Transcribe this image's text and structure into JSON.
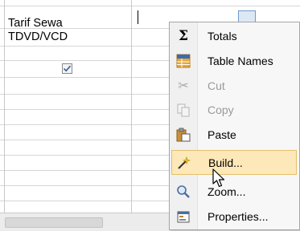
{
  "grid": {
    "field_label_line1": "Tarif Sewa",
    "field_label_line2": "TDVD/VCD",
    "checkbox_checked": true
  },
  "context_menu": {
    "items": [
      {
        "label": "Totals",
        "icon": "sigma-icon",
        "enabled": true,
        "highlighted": false
      },
      {
        "label": "Table Names",
        "icon": "table-names-icon",
        "enabled": true,
        "highlighted": false
      },
      {
        "label": "Cut",
        "icon": "scissors-icon",
        "enabled": false,
        "highlighted": false
      },
      {
        "label": "Copy",
        "icon": "copy-icon",
        "enabled": false,
        "highlighted": false
      },
      {
        "label": "Paste",
        "icon": "paste-icon",
        "enabled": true,
        "highlighted": false
      },
      {
        "label": "Build...",
        "icon": "build-wand-icon",
        "enabled": true,
        "highlighted": true
      },
      {
        "label": "Zoom...",
        "icon": "magnifier-icon",
        "enabled": true,
        "highlighted": false
      },
      {
        "label": "Properties...",
        "icon": "properties-icon",
        "enabled": true,
        "highlighted": false
      }
    ]
  },
  "colors": {
    "highlight_fill": "#fce8b8",
    "highlight_border": "#e4c06a",
    "disabled_text": "#9a9a9a"
  }
}
